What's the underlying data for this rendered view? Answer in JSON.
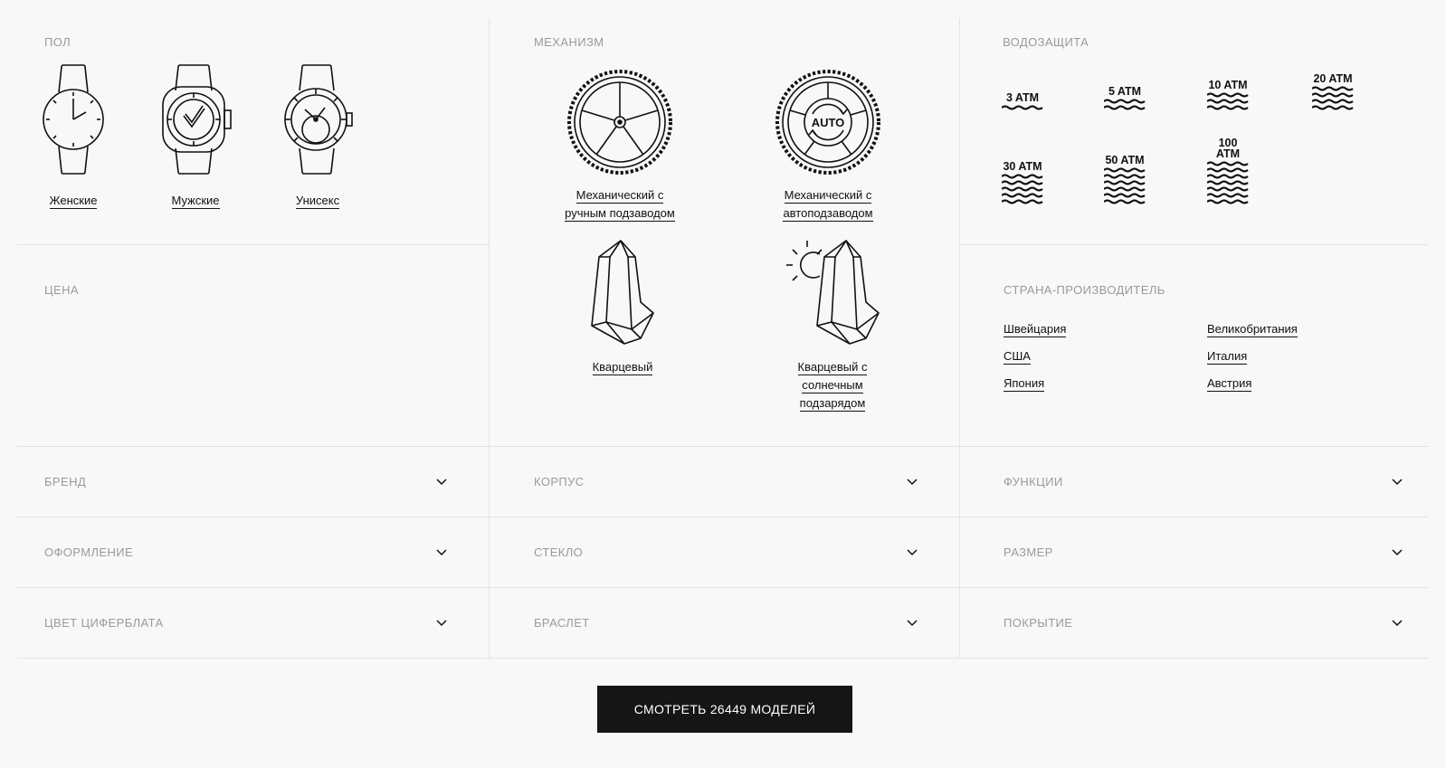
{
  "sections": {
    "gender": {
      "title": "Пол",
      "options": [
        "Женские",
        "Мужские",
        "Унисекс"
      ]
    },
    "mechanism": {
      "title": "Механизм",
      "options": [
        {
          "line1": "Механический с",
          "line2": "ручным подзаводом"
        },
        {
          "line1": "Механический с",
          "line2": "автоподзаводом"
        },
        {
          "line1": "Кварцевый"
        },
        {
          "line1": "Кварцевый с",
          "line2": "солнечным",
          "line3": "подзарядом"
        }
      ],
      "auto_badge": "AUTO"
    },
    "water": {
      "title": "Водозащита",
      "options": [
        "3 ATM",
        "5 ATM",
        "10 ATM",
        "20 ATM",
        "30 ATM",
        "50 ATM",
        "100 ATM"
      ]
    },
    "price": {
      "title": "Цена"
    },
    "country": {
      "title": "Страна-производитель",
      "options": [
        "Швейцария",
        "Великобритания",
        "США",
        "Италия",
        "Япония",
        "Австрия"
      ]
    }
  },
  "accordions": [
    [
      "Бренд",
      "Корпус",
      "Функции"
    ],
    [
      "Оформление",
      "Стекло",
      "Размер"
    ],
    [
      "Цвет циферблата",
      "Браслет",
      "Покрытие"
    ]
  ],
  "cta": {
    "label": "Смотреть 26449 моделей"
  },
  "colors": {
    "background": "#f8f8f8",
    "muted": "#9a9a9a",
    "button": "#151515",
    "divider": "#e3e3e3"
  }
}
